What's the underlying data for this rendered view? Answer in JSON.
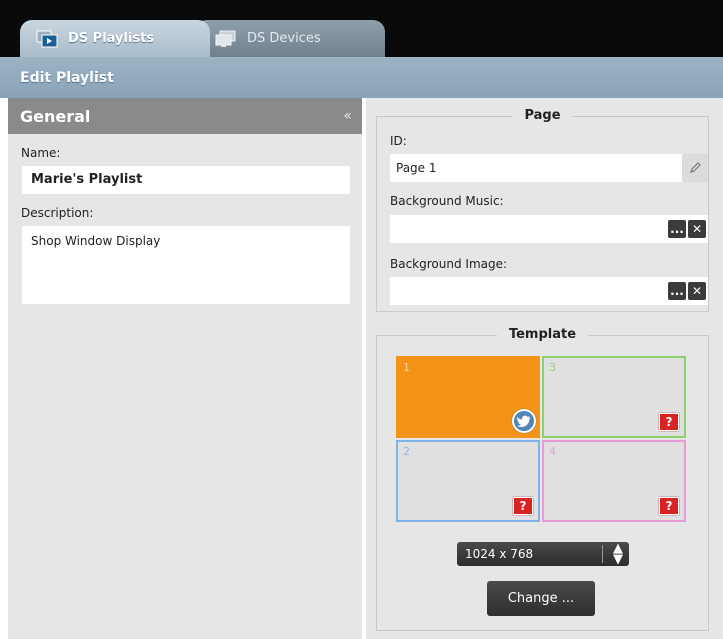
{
  "tabs": [
    {
      "label": "DS Playlists",
      "icon": "playlist-icon",
      "active": true
    },
    {
      "label": "DS Devices",
      "icon": "devices-icon",
      "active": false
    }
  ],
  "subheader": {
    "title": "Edit Playlist"
  },
  "general": {
    "title": "General",
    "collapse_glyph": "«",
    "name_label": "Name:",
    "name_value": "Marie's Playlist",
    "description_label": "Description:",
    "description_value": "Shop Window Display"
  },
  "page": {
    "title": "Page",
    "id_label": "ID:",
    "id_value": "Page 1",
    "bg_music_label": "Background Music:",
    "bg_music_value": "",
    "bg_image_label": "Background Image:",
    "bg_image_value": "",
    "browse_glyph": "...",
    "clear_glyph": "✕"
  },
  "template": {
    "title": "Template",
    "zones": [
      {
        "number": "1",
        "color": "#f39419",
        "content": "twitter"
      },
      {
        "number": "3",
        "color": "#8dcf6a",
        "content": "unknown"
      },
      {
        "number": "2",
        "color": "#7fb2e5",
        "content": "unknown"
      },
      {
        "number": "4",
        "color": "#e69ad6",
        "content": "unknown"
      }
    ],
    "unknown_glyph": "?",
    "resolution": "1024 x 768",
    "change_label": "Change ..."
  }
}
